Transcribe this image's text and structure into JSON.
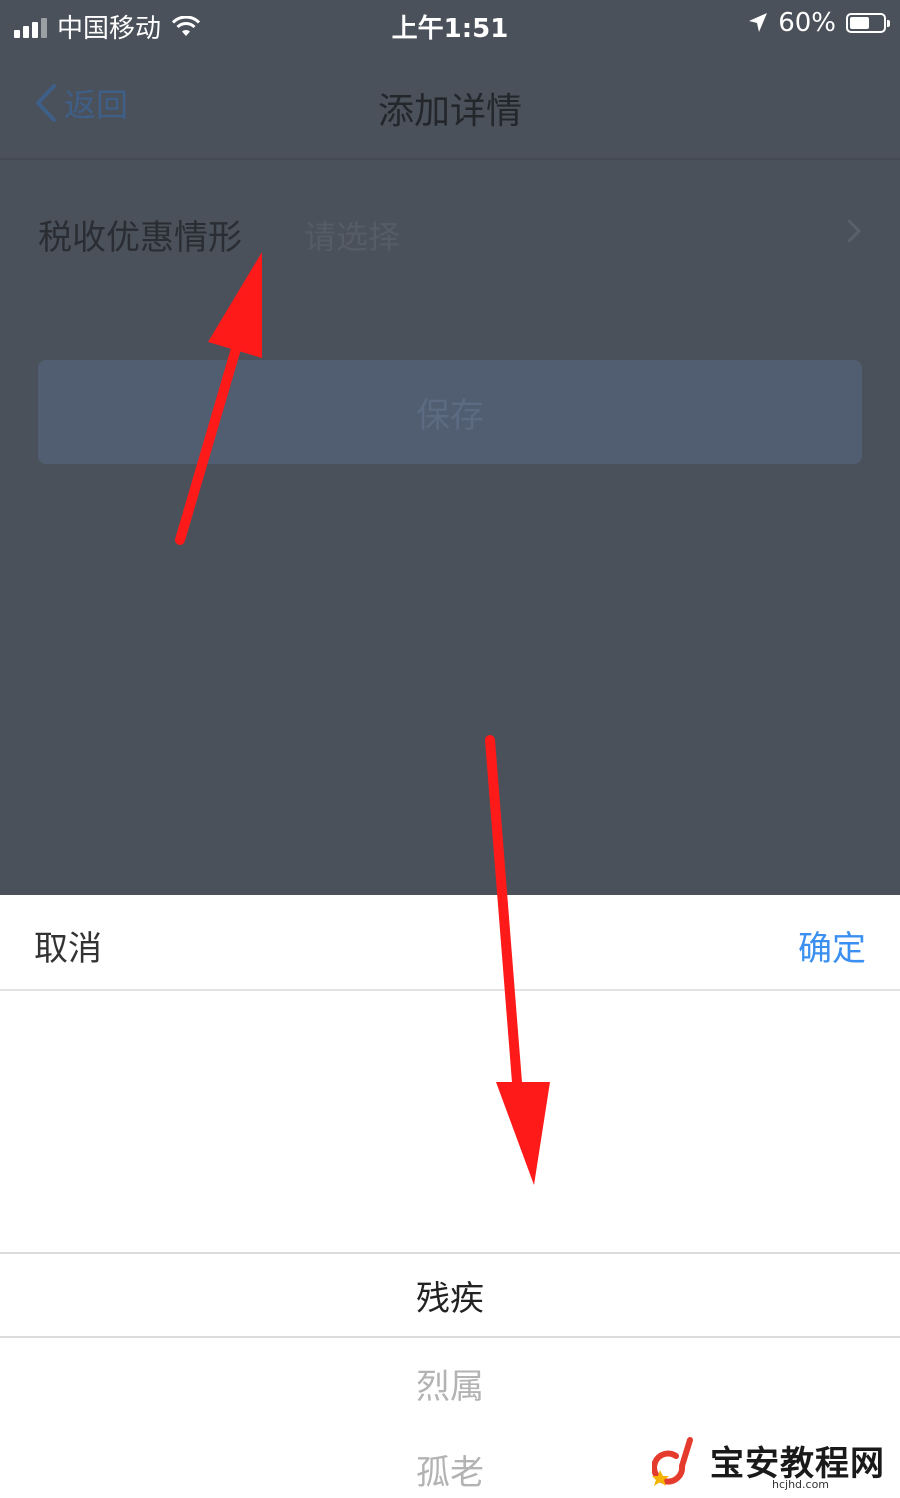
{
  "status_bar": {
    "carrier": "中国移动",
    "time": "上午1:51",
    "battery_percent": "60%",
    "battery_level": 0.6,
    "icons": [
      "signal-icon",
      "wifi-icon",
      "location-arrow-icon",
      "battery-icon"
    ]
  },
  "nav": {
    "back_label": "返回",
    "title": "添加详情"
  },
  "form": {
    "field_label": "税收优惠情形",
    "field_placeholder": "请选择",
    "save_label": "保存"
  },
  "picker": {
    "cancel_label": "取消",
    "confirm_label": "确定",
    "options": [
      "残疾",
      "烈属",
      "孤老"
    ],
    "selected_index": 0
  },
  "watermark": {
    "text": "宝安教程网",
    "subtext": "hcjhd.com"
  },
  "colors": {
    "overlay": "#4b515a",
    "accent": "#3a8ff0",
    "arrow": "#ff1a1a"
  }
}
